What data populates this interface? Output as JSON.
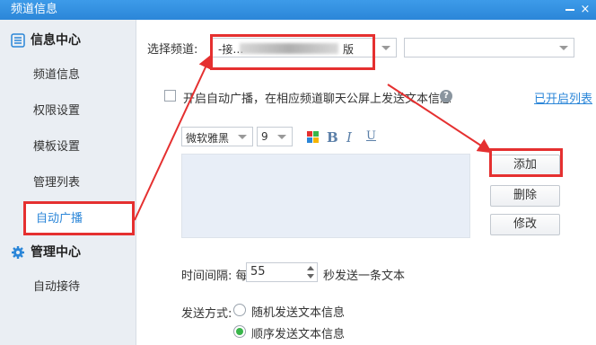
{
  "window": {
    "title": "频道信息",
    "close_glyph": "×"
  },
  "sidebar": {
    "groups": [
      {
        "label": "信息中心",
        "icon": "list-icon",
        "items": [
          "频道信息",
          "权限设置",
          "模板设置",
          "管理列表",
          "自动广播"
        ]
      },
      {
        "label": "管理中心",
        "icon": "gear-icon",
        "items": [
          "自动接待"
        ]
      }
    ],
    "active_item": "自动广播"
  },
  "main": {
    "select_channel_label": "选择频道:",
    "channel_value": "-接…",
    "channel_value_suffix": "版",
    "enable_label": "开启自动广播，在相应频道聊天公屏上发送文本信息",
    "help_glyph": "?",
    "enabled_list_link": "已开启列表",
    "font_name": "微软雅黑",
    "font_size": "9",
    "bold": "B",
    "italic": "I",
    "underline": "U",
    "add_button": "添加",
    "delete_button": "删除",
    "modify_button": "修改",
    "interval_label": "时间间隔: 每",
    "interval_value": "55",
    "interval_suffix": "秒发送一条文本",
    "send_mode_label": "发送方式:",
    "send_random": "随机发送文本信息",
    "send_sequential": "顺序发送文本信息",
    "send_mode_selected": "顺序发送文本信息"
  },
  "colors": {
    "accent": "#2b86d8",
    "annotation": "#e53030",
    "radio_on": "#39b54a"
  }
}
